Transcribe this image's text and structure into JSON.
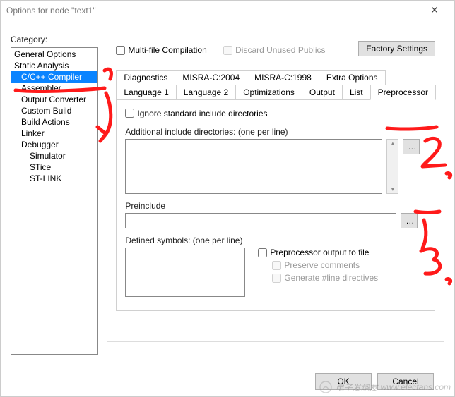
{
  "window": {
    "title": "Options for node \"text1\"",
    "close_glyph": "✕"
  },
  "category": {
    "label": "Category:",
    "items": [
      {
        "label": "General Options",
        "indent": 0
      },
      {
        "label": "Static Analysis",
        "indent": 0
      },
      {
        "label": "C/C++ Compiler",
        "indent": 1,
        "selected": true
      },
      {
        "label": "Assembler",
        "indent": 1
      },
      {
        "label": "Output Converter",
        "indent": 1
      },
      {
        "label": "Custom Build",
        "indent": 1
      },
      {
        "label": "Build Actions",
        "indent": 1
      },
      {
        "label": "Linker",
        "indent": 1
      },
      {
        "label": "Debugger",
        "indent": 1
      },
      {
        "label": "Simulator",
        "indent": 2
      },
      {
        "label": "STice",
        "indent": 2
      },
      {
        "label": "ST-LINK",
        "indent": 2
      }
    ]
  },
  "right": {
    "factory_settings": "Factory Settings",
    "multi_file": "Multi-file Compilation",
    "discard": "Discard Unused Publics",
    "tabs_row1": [
      "Diagnostics",
      "MISRA-C:2004",
      "MISRA-C:1998",
      "Extra Options"
    ],
    "tabs_row2": [
      "Language 1",
      "Language 2",
      "Optimizations",
      "Output",
      "List",
      "Preprocessor"
    ],
    "active_tab": "Preprocessor",
    "ignore_std": "Ignore standard include directories",
    "add_inc_label": "Additional include directories: (one per line)",
    "add_inc_value": "",
    "browse_glyph": "…",
    "preinclude_label": "Preinclude",
    "preinclude_value": "",
    "defined_label": "Defined symbols: (one per line)",
    "defined_value": "",
    "pp_out": "Preprocessor output to file",
    "preserve": "Preserve comments",
    "gen_line": "Generate #line directives"
  },
  "footer": {
    "ok": "OK",
    "cancel": "Cancel"
  },
  "watermark": {
    "text": "www.elecfans.com",
    "brand": "电子发烧友"
  },
  "annotations": {
    "color": "#ff1a1a",
    "marks": [
      "underline-compiler",
      "arrow-1",
      "label-2",
      "arrow-3",
      "label-3"
    ]
  }
}
